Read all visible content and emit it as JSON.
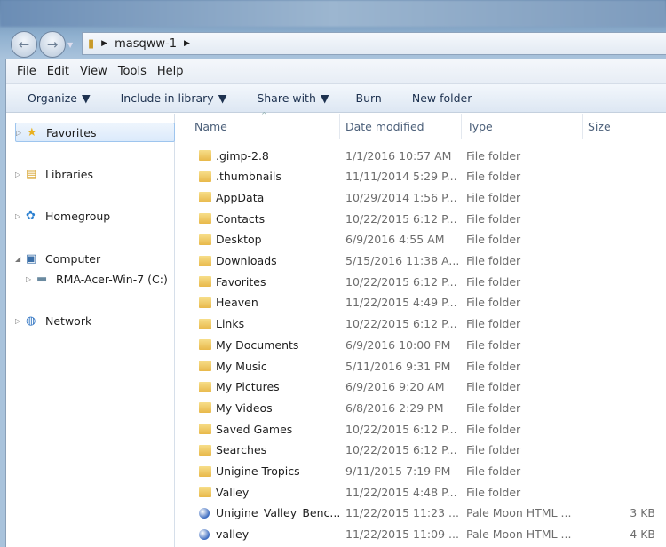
{
  "address": {
    "path": [
      "masqww-1"
    ]
  },
  "menu": [
    "File",
    "Edit",
    "View",
    "Tools",
    "Help"
  ],
  "toolbar": [
    {
      "label": "Organize",
      "dropdown": true
    },
    {
      "label": "Include in library",
      "dropdown": true
    },
    {
      "label": "Share with",
      "dropdown": true
    },
    {
      "label": "Burn",
      "dropdown": false
    },
    {
      "label": "New folder",
      "dropdown": false
    }
  ],
  "sidebar": [
    {
      "label": "Favorites",
      "icon": "star-icon",
      "selected": true
    },
    {
      "label": "Libraries",
      "icon": "libraries-icon"
    },
    {
      "label": "Homegroup",
      "icon": "homegroup-icon"
    },
    {
      "label": "Computer",
      "icon": "computer-icon",
      "expanded": true
    },
    {
      "label": "RMA-Acer-Win-7 (C:)",
      "icon": "drive-icon",
      "child": true
    },
    {
      "label": "Network",
      "icon": "network-icon"
    }
  ],
  "columns": [
    "Name",
    "Date modified",
    "Type",
    "Size"
  ],
  "files": [
    {
      "name": ".gimp-2.8",
      "date": "1/1/2016 10:57 AM",
      "type": "File folder",
      "size": "",
      "kind": "folder"
    },
    {
      "name": ".thumbnails",
      "date": "11/11/2014 5:29 P...",
      "type": "File folder",
      "size": "",
      "kind": "folder"
    },
    {
      "name": "AppData",
      "date": "10/29/2014 1:56 P...",
      "type": "File folder",
      "size": "",
      "kind": "folder"
    },
    {
      "name": "Contacts",
      "date": "10/22/2015 6:12 P...",
      "type": "File folder",
      "size": "",
      "kind": "folder"
    },
    {
      "name": "Desktop",
      "date": "6/9/2016 4:55 AM",
      "type": "File folder",
      "size": "",
      "kind": "folder"
    },
    {
      "name": "Downloads",
      "date": "5/15/2016 11:38 A...",
      "type": "File folder",
      "size": "",
      "kind": "folder"
    },
    {
      "name": "Favorites",
      "date": "10/22/2015 6:12 P...",
      "type": "File folder",
      "size": "",
      "kind": "folder"
    },
    {
      "name": "Heaven",
      "date": "11/22/2015 4:49 P...",
      "type": "File folder",
      "size": "",
      "kind": "folder"
    },
    {
      "name": "Links",
      "date": "10/22/2015 6:12 P...",
      "type": "File folder",
      "size": "",
      "kind": "folder"
    },
    {
      "name": "My Documents",
      "date": "6/9/2016 10:00 PM",
      "type": "File folder",
      "size": "",
      "kind": "folder"
    },
    {
      "name": "My Music",
      "date": "5/11/2016 9:31 PM",
      "type": "File folder",
      "size": "",
      "kind": "folder"
    },
    {
      "name": "My Pictures",
      "date": "6/9/2016 9:20 AM",
      "type": "File folder",
      "size": "",
      "kind": "folder"
    },
    {
      "name": "My Videos",
      "date": "6/8/2016 2:29 PM",
      "type": "File folder",
      "size": "",
      "kind": "folder"
    },
    {
      "name": "Saved Games",
      "date": "10/22/2015 6:12 P...",
      "type": "File folder",
      "size": "",
      "kind": "folder"
    },
    {
      "name": "Searches",
      "date": "10/22/2015 6:12 P...",
      "type": "File folder",
      "size": "",
      "kind": "folder"
    },
    {
      "name": "Unigine Tropics",
      "date": "9/11/2015 7:19 PM",
      "type": "File folder",
      "size": "",
      "kind": "folder"
    },
    {
      "name": "Valley",
      "date": "11/22/2015 4:48 P...",
      "type": "File folder",
      "size": "",
      "kind": "folder"
    },
    {
      "name": "Unigine_Valley_Benc...",
      "date": "11/22/2015 11:23 ...",
      "type": "Pale Moon HTML ...",
      "size": "3 KB",
      "kind": "html"
    },
    {
      "name": "valley",
      "date": "11/22/2015 11:09 ...",
      "type": "Pale Moon HTML ...",
      "size": "4 KB",
      "kind": "html"
    }
  ]
}
